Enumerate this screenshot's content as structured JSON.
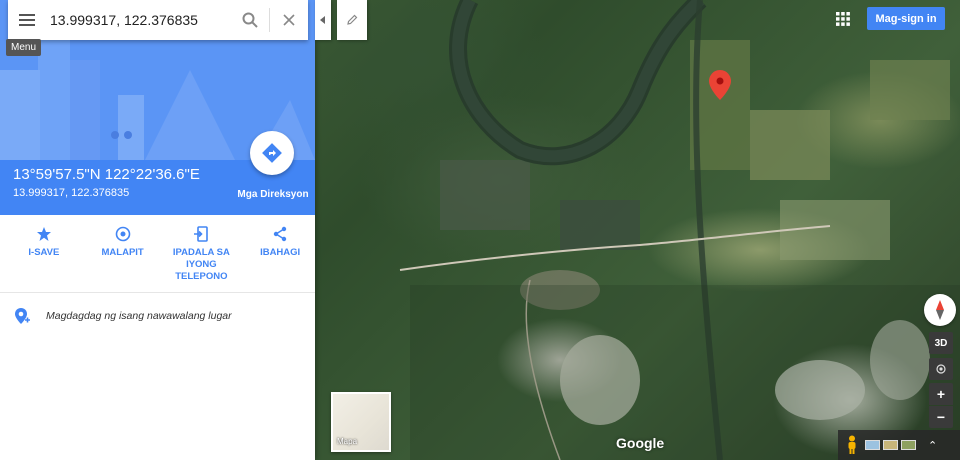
{
  "search": {
    "query": "13.999317, 122.376835",
    "menu_tooltip": "Menu",
    "menu_icon": "hamburger-menu-icon",
    "search_icon": "search-icon",
    "clear_icon": "close-icon"
  },
  "place": {
    "dms": "13°59'57.5\"N 122°22'36.6\"E",
    "decimal": "13.999317, 122.376835",
    "directions_label": "Mga Direksyon"
  },
  "actions": [
    {
      "label": "I-SAVE",
      "icon": "star-icon"
    },
    {
      "label": "MALAPIT",
      "icon": "nearby-icon"
    },
    {
      "label": "IPADALA SA IYONG TELEPONO",
      "icon": "send-to-phone-icon"
    },
    {
      "label": "IBAHAGI",
      "icon": "share-icon"
    }
  ],
  "add_place": {
    "label": "Magdagdag ng isang nawawalang lugar",
    "icon": "add-place-icon"
  },
  "header": {
    "signin_label": "Mag-sign in",
    "apps_icon": "apps-grid-icon"
  },
  "map_controls": {
    "label_3d": "3D",
    "zoom_in": "+",
    "zoom_out": "−",
    "expand": "⌃"
  },
  "minimap": {
    "label": "Mapa"
  },
  "brand": {
    "logo_text": "Google"
  },
  "colors": {
    "accent": "#4285f4",
    "marker": "#ea4335",
    "panel_bg": "#ffffff"
  }
}
